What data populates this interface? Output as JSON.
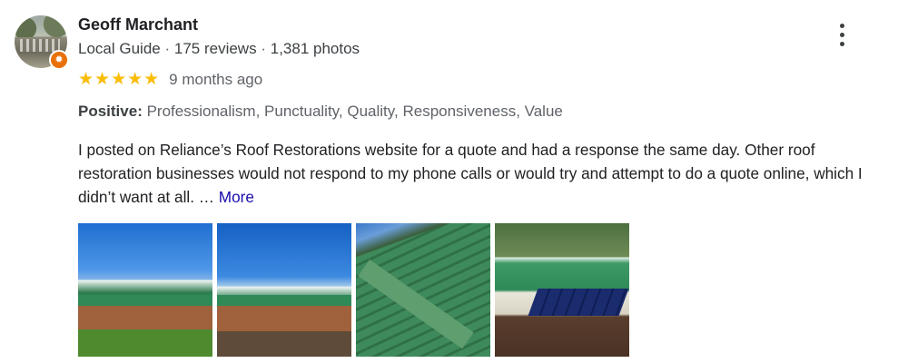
{
  "reviewer": {
    "name": "Geoff Marchant",
    "role": "Local Guide",
    "reviews": "175 reviews",
    "photos": "1,381 photos",
    "separator": "·"
  },
  "rating": {
    "stars": 5,
    "stars_text": "★★★★★",
    "when": "9 months ago"
  },
  "positive": {
    "label": "Positive:",
    "values": "Professionalism, Punctuality, Quality, Responsiveness, Value"
  },
  "review": {
    "text": "I posted on Reliance’s Roof Restorations website for a quote and had a response the same day.  Other roof restoration businesses would not respond to my phone calls or would try and attempt to do a quote online, which I didn’t want at all. …",
    "more": "More"
  },
  "colors": {
    "star": "#fbbc04",
    "link": "#1a0dab",
    "badge": "#e8710a"
  },
  "icons": {
    "menu": "more-vert-icon",
    "badge": "local-guide-star-icon"
  }
}
